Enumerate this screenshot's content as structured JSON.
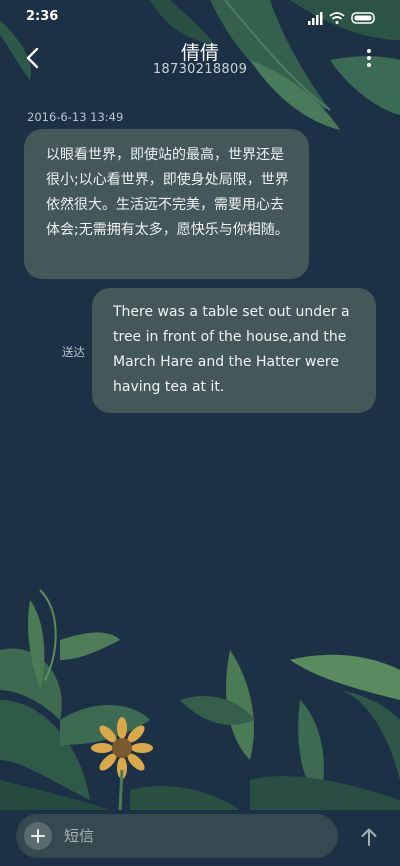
{
  "status_bar": {
    "time": "2:36"
  },
  "header": {
    "contact_name": "倩倩",
    "contact_number": "18730218809"
  },
  "conversation": {
    "timestamp": "2016-6-13 13:49",
    "incoming_message": "以眼看世界，即使站的最高，世界还是很小;以心看世界，即使身处局限，世界依然很大。生活远不完美，需要用心去体会;无需拥有太多，愿快乐与你相随。",
    "outgoing_message": "There was a table set out under a tree in front of the house,and the March Hare and the Hatter were having tea at it.",
    "outgoing_status": "送达"
  },
  "composer": {
    "placeholder": "短信"
  },
  "icons": {
    "back": "chevron-left-icon",
    "more": "more-vertical-icon",
    "add": "plus-icon",
    "send": "arrow-up-icon",
    "signal": "signal-icon",
    "wifi": "wifi-icon",
    "battery": "battery-icon"
  },
  "colors": {
    "background": "#1c3146",
    "bubble": "#50645f",
    "foliage": "#2e5a4a"
  }
}
